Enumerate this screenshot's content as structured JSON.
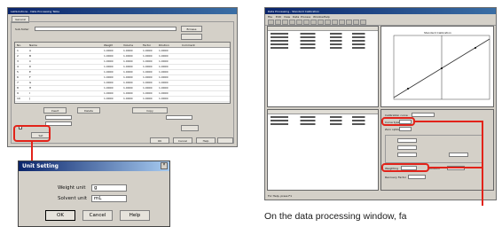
{
  "left_window": {
    "title": "LabSolutions - Data Processing Table",
    "tab": "General",
    "path_label": "Sub-folder:",
    "browse_label": "Browse",
    "table_headers": [
      "No.",
      "Name",
      "Weight",
      "Volume",
      "Factor",
      "Dilution",
      "Comment"
    ],
    "rows": [
      [
        "1",
        "A",
        "1.0000",
        "1.0000",
        "1.0000",
        "1.0000",
        ""
      ],
      [
        "2",
        "B",
        "1.0000",
        "1.0000",
        "1.0000",
        "1.0000",
        ""
      ],
      [
        "3",
        "C",
        "1.0000",
        "1.0000",
        "1.0000",
        "1.0000",
        ""
      ],
      [
        "4",
        "D",
        "1.0000",
        "1.0000",
        "1.0000",
        "1.0000",
        ""
      ],
      [
        "5",
        "E",
        "1.0000",
        "1.0000",
        "1.0000",
        "1.0000",
        ""
      ],
      [
        "6",
        "F",
        "1.0000",
        "1.0000",
        "1.0000",
        "1.0000",
        ""
      ],
      [
        "7",
        "G",
        "1.0000",
        "1.0000",
        "1.0000",
        "1.0000",
        ""
      ],
      [
        "8",
        "H",
        "1.0000",
        "1.0000",
        "1.0000",
        "1.0000",
        ""
      ],
      [
        "9",
        "I",
        "1.0000",
        "1.0000",
        "1.0000",
        "1.0000",
        ""
      ],
      [
        "10",
        "J",
        "1.0000",
        "1.0000",
        "1.0000",
        "1.0000",
        ""
      ]
    ],
    "buttons": [
      "Insert",
      "Delete",
      "Copy",
      "OK",
      "Cancel",
      "Help"
    ],
    "unit_button": "Set"
  },
  "dialog": {
    "title": "Unit Setting",
    "weight_label": "Weight unit",
    "weight_value": "g",
    "solvent_label": "Solvent unit",
    "solvent_value": "mL",
    "ok_label": "OK",
    "cancel_label": "Cancel",
    "help_label": "Help"
  },
  "right_window": {
    "title": "Data Processing - Standard Calibration",
    "menu": [
      "File",
      "Edit",
      "View",
      "Data",
      "Process",
      "Window",
      "Help"
    ],
    "chart_title": "Standard Calibration",
    "status": "For Help, press F1",
    "fields": [
      "Calibration curve",
      "Curve type",
      "Zero option",
      "Weighting",
      "Dilution",
      "Recovery Factor"
    ]
  },
  "caption": "On the data processing window, fa",
  "colors": {
    "highlight": "#e2231a",
    "titlebar": "#0a246a",
    "face": "#d4d0c8"
  }
}
